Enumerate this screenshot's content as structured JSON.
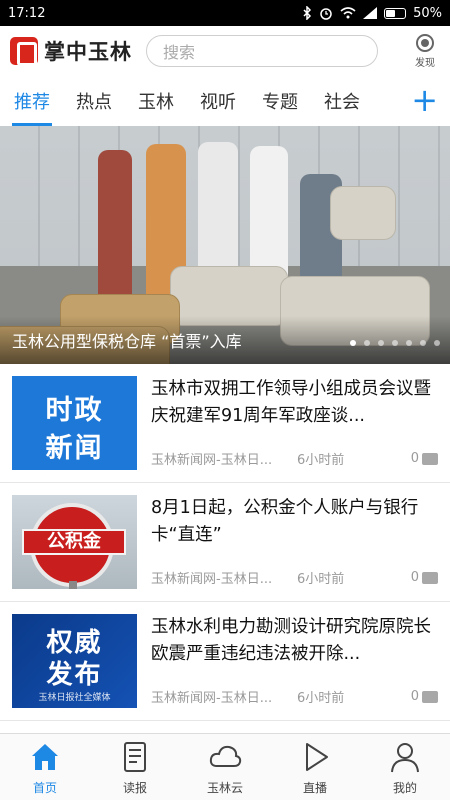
{
  "status_bar": {
    "time": "17:12",
    "battery": "50%"
  },
  "header": {
    "app_name": "掌中玉林",
    "search_placeholder": "搜索",
    "discover_label": "发现"
  },
  "tabs": [
    {
      "label": "推荐",
      "active": true
    },
    {
      "label": "热点"
    },
    {
      "label": "玉林"
    },
    {
      "label": "视听"
    },
    {
      "label": "专题"
    },
    {
      "label": "社会"
    }
  ],
  "banner": {
    "caption": "玉林公用型保税仓库 “首票”入库",
    "slide_count": 7,
    "current_slide": 1
  },
  "news": [
    {
      "title": "玉林市双拥工作领导小组成员会议暨庆祝建军91周年军政座谈...",
      "source": "玉林新闻网-玉林日...",
      "time": "6小时前",
      "comments": "0",
      "thumb_line1": "时政",
      "thumb_line2": "新闻"
    },
    {
      "title": "8月1日起，公积金个人账户与银行卡“直连”",
      "source": "玉林新闻网-玉林日...",
      "time": "6小时前",
      "comments": "0",
      "thumb_text": "公积金"
    },
    {
      "title": "玉林水利电力勘测设计研究院原院长欧震严重违纪违法被开除...",
      "source": "玉林新闻网-玉林日...",
      "time": "6小时前",
      "comments": "0",
      "thumb_line1": "权威",
      "thumb_line2": "发布",
      "thumb_small": "玉林日报社全媒体"
    }
  ],
  "bottom_nav": [
    {
      "label": "首页",
      "icon": "home-icon",
      "active": true
    },
    {
      "label": "读报",
      "icon": "newspaper-icon"
    },
    {
      "label": "玉林云",
      "icon": "cloud-icon"
    },
    {
      "label": "直播",
      "icon": "play-icon"
    },
    {
      "label": "我的",
      "icon": "person-icon"
    }
  ],
  "colors": {
    "accent": "#1e88e5",
    "brand_red": "#d9261c"
  }
}
